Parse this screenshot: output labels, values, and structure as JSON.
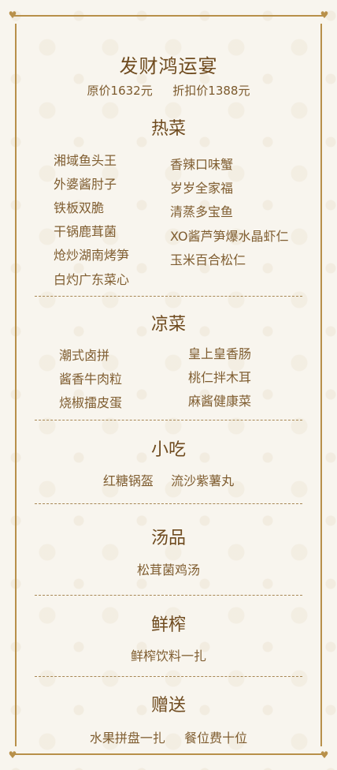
{
  "menu": {
    "title": "发财鸿运宴",
    "original_price": "原价1632元",
    "discount_price": "折扣价1388元"
  },
  "sections": {
    "hot": {
      "title": "热菜",
      "left": [
        "湘域鱼头王",
        "外婆酱肘子",
        "铁板双脆",
        "干锅鹿茸菌",
        "炝炒湖南烤笋",
        "白灼广东菜心"
      ],
      "right": [
        "香辣口味蟹",
        "岁岁全家福",
        "清蒸多宝鱼",
        "XO酱芦笋爆水晶虾仁",
        "玉米百合松仁"
      ]
    },
    "cold": {
      "title": "凉菜",
      "left": [
        "潮式卤拼",
        "酱香牛肉粒",
        "烧椒擂皮蛋"
      ],
      "right": [
        "皇上皇香肠",
        "桃仁拌木耳",
        "麻酱健康菜"
      ]
    },
    "snack": {
      "title": "小吃",
      "items": [
        "红糖锅盔",
        "流沙紫薯丸"
      ]
    },
    "soup": {
      "title": "汤品",
      "items": [
        "松茸菌鸡汤"
      ]
    },
    "juice": {
      "title": "鲜榨",
      "items": [
        "鲜榨饮料一扎"
      ]
    },
    "gift": {
      "title": "赠送",
      "items": [
        "水果拼盘一扎",
        "餐位费十位"
      ]
    }
  },
  "theme": {
    "gold": "#b8904a",
    "text": "#7a5a2a",
    "background": "#f8f5ee"
  },
  "icons": [
    "heart-icon",
    "heart-icon",
    "heart-icon",
    "heart-icon"
  ]
}
